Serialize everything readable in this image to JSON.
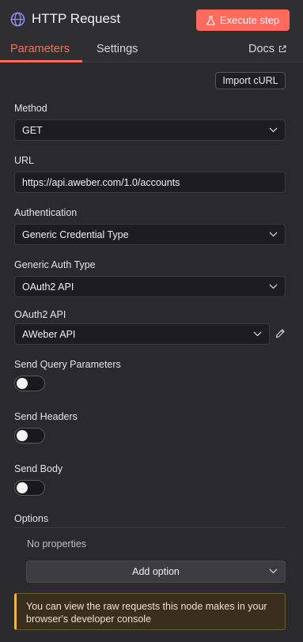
{
  "header": {
    "title": "HTTP Request",
    "execute_label": "Execute step"
  },
  "tabs": {
    "parameters": "Parameters",
    "settings": "Settings",
    "docs": "Docs"
  },
  "import_curl": "Import cURL",
  "method": {
    "label": "Method",
    "value": "GET"
  },
  "url": {
    "label": "URL",
    "value": "https://api.aweber.com/1.0/accounts"
  },
  "authentication": {
    "label": "Authentication",
    "value": "Generic Credential Type"
  },
  "generic_auth_type": {
    "label": "Generic Auth Type",
    "value": "OAuth2 API"
  },
  "oauth2_api": {
    "label": "OAuth2 API",
    "value": "AWeber API"
  },
  "send_query": {
    "label": "Send Query Parameters",
    "enabled": false
  },
  "send_headers": {
    "label": "Send Headers",
    "enabled": false
  },
  "send_body": {
    "label": "Send Body",
    "enabled": false
  },
  "options": {
    "label": "Options",
    "empty_text": "No properties",
    "add_label": "Add option"
  },
  "notice": {
    "text": "You can view the raw requests this node makes in your browser's developer console"
  },
  "colors": {
    "accent": "#ff6d5a",
    "execute_bg": "#ff6b5c",
    "notice_border": "#f0b34a"
  },
  "icons": {
    "node": "globe-icon",
    "execute": "flask-icon",
    "docs": "external-link-icon",
    "edit": "pencil-icon",
    "dropdown": "chevron-down-icon"
  }
}
